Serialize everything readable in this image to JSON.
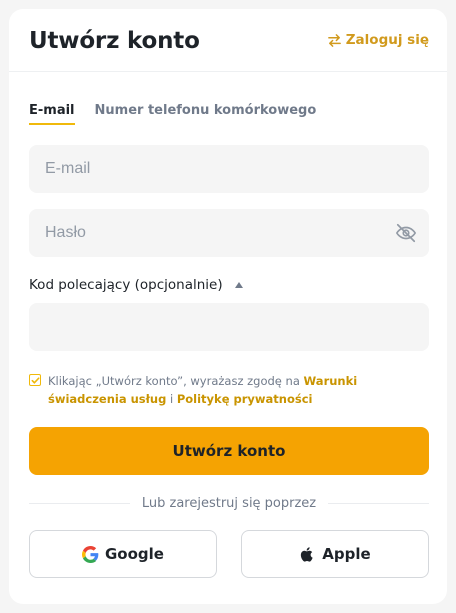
{
  "header": {
    "title": "Utwórz konto",
    "login_label": "Zaloguj się"
  },
  "tabs": [
    {
      "label": "E-mail",
      "active": true
    },
    {
      "label": "Numer telefonu komórkowego",
      "active": false
    }
  ],
  "form": {
    "email_placeholder": "E-mail",
    "email_value": "",
    "password_placeholder": "Hasło",
    "password_value": "",
    "referral_label": "Kod polecający (opcjonalnie)",
    "referral_value": "",
    "consent_prefix": "Klikając „Utwórz konto”, wyrażasz zgodę na ",
    "consent_link1": "Warunki świadczenia usług",
    "consent_mid": " i ",
    "consent_link2": "Politykę prywatności",
    "consent_checked": true,
    "submit_label": "Utwórz konto"
  },
  "social": {
    "divider_text": "Lub zarejestruj się poprzez",
    "google_label": "Google",
    "apple_label": "Apple"
  },
  "icons": {
    "swap": "swap-arrows-icon",
    "eye": "eye-off-icon",
    "caret": "caret-up-icon",
    "check": "check-icon",
    "google": "google-logo-icon",
    "apple": "apple-logo-icon"
  },
  "colors": {
    "accent": "#f0b90b",
    "primary_button": "#f5a302",
    "link": "#c99400",
    "text": "#1e2329",
    "muted": "#707a8a",
    "input_bg": "#f5f5f5"
  }
}
